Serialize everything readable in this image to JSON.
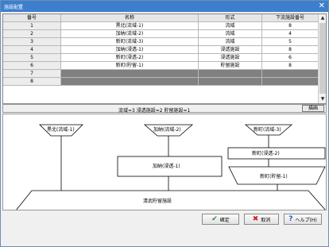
{
  "window": {
    "title": "施設配置",
    "close_glyph": "✕"
  },
  "grid": {
    "headers": [
      "番号",
      "名称",
      "形式",
      "下流施設番号"
    ],
    "rows": [
      [
        "1",
        "黒北(流域-1)",
        "流域",
        "8"
      ],
      [
        "2",
        "加納(流域-2)",
        "流域",
        "4"
      ],
      [
        "3",
        "新町(流域-3)",
        "流域",
        "5"
      ],
      [
        "4",
        "加納(浸透-1)",
        "浸透施設",
        "8"
      ],
      [
        "5",
        "新町(浸透-2)",
        "浸透施設",
        "6"
      ],
      [
        "6",
        "新町(貯留-1)",
        "貯留施設",
        "8"
      ],
      [
        "7",
        "",
        "",
        ""
      ],
      [
        "8",
        "",
        "",
        ""
      ]
    ]
  },
  "summary": {
    "text": "流域=3 浸透施設=2 貯留施設=1",
    "draw_button": "描画"
  },
  "diagram": {
    "labels": {
      "basin1": "黒北(流域-1)",
      "basin2": "加納(流域-2)",
      "basin3": "新町(流域-3)",
      "infil1": "加納(浸透-1)",
      "infil2": "新町(浸透-2)",
      "storage1": "新町(貯留-1)",
      "final": "清武貯留施設"
    }
  },
  "footer": {
    "ok": "確定",
    "cancel": "取消",
    "help": "ヘルプ(H)"
  },
  "icons": {
    "ok": "check-icon",
    "cancel": "x-icon",
    "help": "question-icon"
  },
  "colors": {
    "titlebar": "#3d7fcd",
    "ok_check": "#2e8b3a",
    "cancel_x": "#cc2222",
    "help_q": "#1f5fbf"
  }
}
